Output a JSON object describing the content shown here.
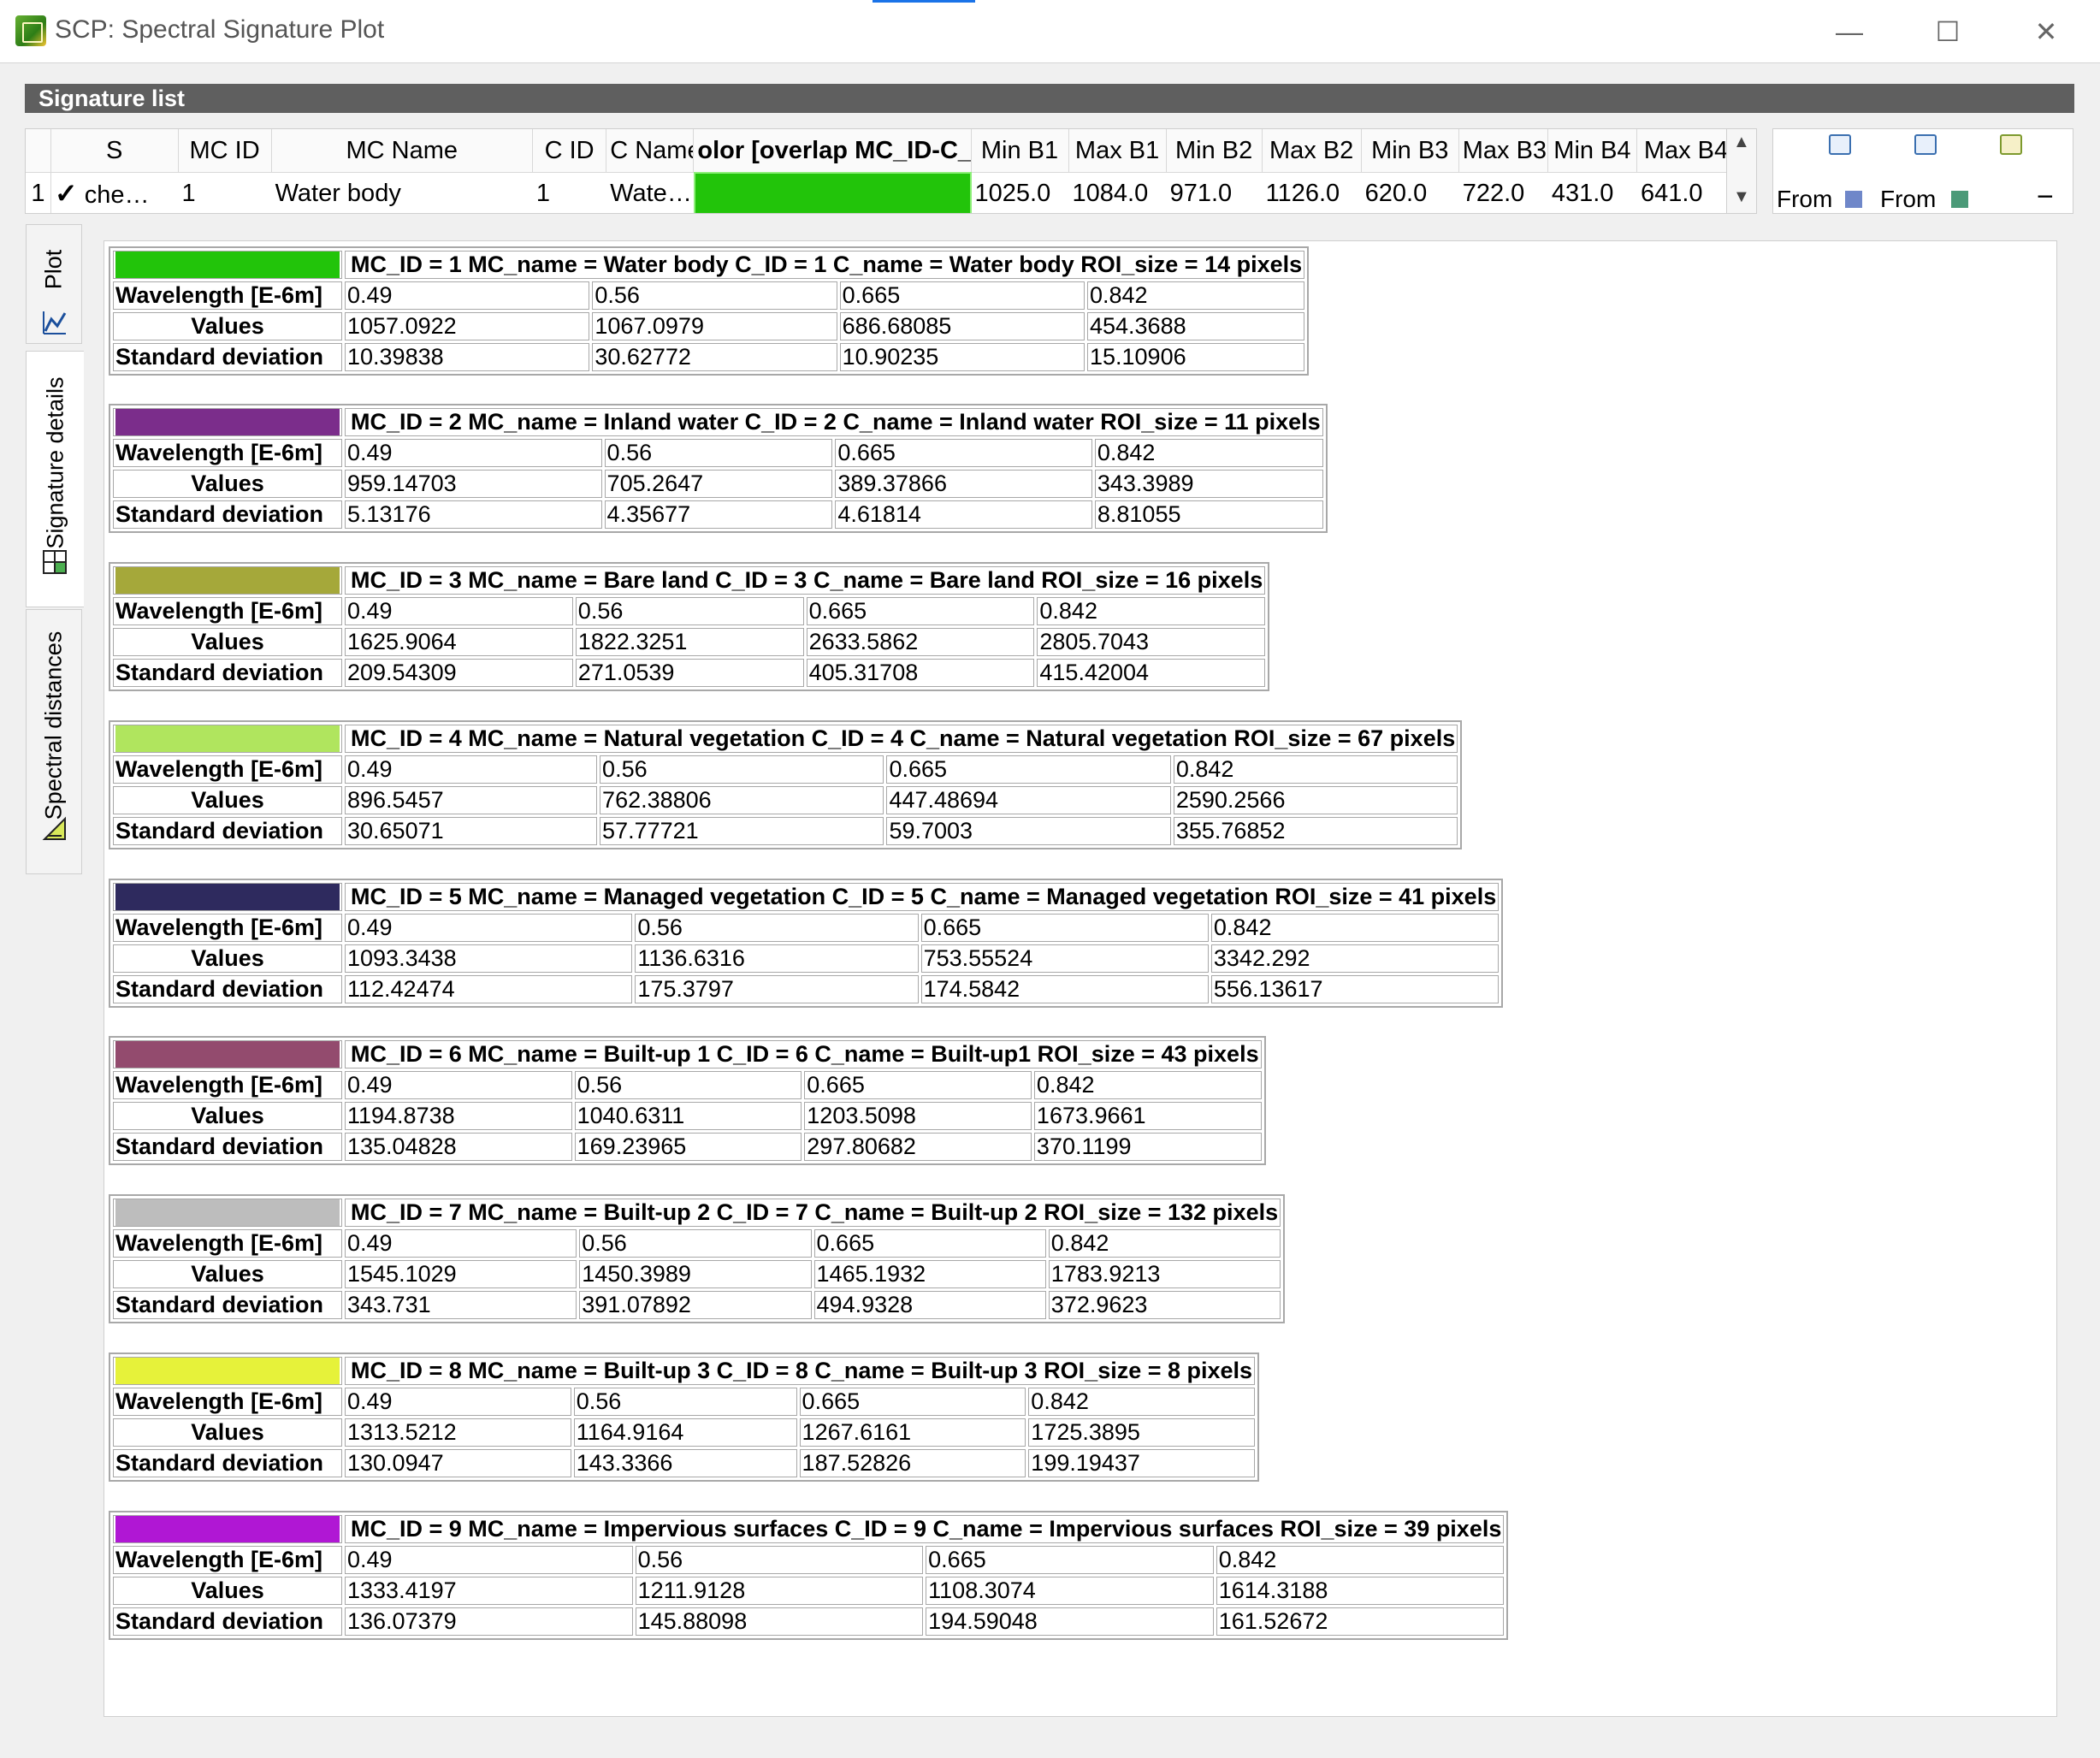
{
  "window": {
    "title": "SCP: Spectral Signature Plot",
    "minimize_icon": "minimize-icon",
    "maximize_icon": "maximize-icon",
    "close_icon": "close-icon"
  },
  "signature_list": {
    "header": "Signature list",
    "columns": [
      "S",
      "MC ID",
      "MC Name",
      "C ID",
      "C Name",
      "olor [overlap MC_ID-C_I",
      "Min B1",
      "Max B1",
      "Min B2",
      "Max B2",
      "Min B3",
      "Max B3",
      "Min B4",
      "Max B4"
    ],
    "row": {
      "index": "1",
      "check": "✓",
      "s": "che…",
      "mc_id": "1",
      "mc_name": "Water body",
      "c_id": "1",
      "c_name": "Wate…",
      "color": "#22c40a",
      "min_b1": "1025.0",
      "max_b1": "1084.0",
      "min_b2": "971.0",
      "max_b2": "1126.0",
      "min_b3": "620.0",
      "max_b3": "722.0",
      "min_b4": "431.0",
      "max_b4": "641.0"
    },
    "side_tools": {
      "from_label_1": "From",
      "from_label_2": "From",
      "minus_symbol": "−"
    }
  },
  "tabs": {
    "plot": "Plot",
    "signature_details": "Signature details",
    "spectral_distances": "Spectral distances"
  },
  "row_labels": {
    "wavelength": "Wavelength [E-6m]",
    "values": "Values",
    "std": "Standard deviation"
  },
  "signatures": [
    {
      "color": "#22c40a",
      "title": "MC_ID = 1 MC_name = Water body C_ID = 1 C_name = Water body ROI_size = 14 pixels",
      "wavelengths": [
        "0.49",
        "0.56",
        "0.665",
        "0.842"
      ],
      "values": [
        "1057.0922",
        "1067.0979",
        "686.68085",
        "454.3688"
      ],
      "std": [
        "10.39838",
        "30.62772",
        "10.90235",
        "15.10906"
      ]
    },
    {
      "color": "#7b2d8b",
      "title": "MC_ID = 2 MC_name = Inland water C_ID = 2 C_name = Inland water ROI_size = 11 pixels",
      "wavelengths": [
        "0.49",
        "0.56",
        "0.665",
        "0.842"
      ],
      "values": [
        "959.14703",
        "705.2647",
        "389.37866",
        "343.3989"
      ],
      "std": [
        "5.13176",
        "4.35677",
        "4.61814",
        "8.81055"
      ]
    },
    {
      "color": "#a5a83a",
      "title": "MC_ID = 3 MC_name = Bare land C_ID = 3 C_name = Bare land ROI_size = 16 pixels",
      "wavelengths": [
        "0.49",
        "0.56",
        "0.665",
        "0.842"
      ],
      "values": [
        "1625.9064",
        "1822.3251",
        "2633.5862",
        "2805.7043"
      ],
      "std": [
        "209.54309",
        "271.0539",
        "405.31708",
        "415.42004"
      ]
    },
    {
      "color": "#b0e55e",
      "title": "MC_ID = 4 MC_name = Natural vegetation C_ID = 4 C_name = Natural vegetation ROI_size = 67 pixels",
      "wavelengths": [
        "0.49",
        "0.56",
        "0.665",
        "0.842"
      ],
      "values": [
        "896.5457",
        "762.38806",
        "447.48694",
        "2590.2566"
      ],
      "std": [
        "30.65071",
        "57.77721",
        "59.7003",
        "355.76852"
      ]
    },
    {
      "color": "#2e2a5e",
      "title": "MC_ID = 5 MC_name = Managed vegetation C_ID = 5 C_name = Managed vegetation ROI_size = 41 pixels",
      "wavelengths": [
        "0.49",
        "0.56",
        "0.665",
        "0.842"
      ],
      "values": [
        "1093.3438",
        "1136.6316",
        "753.55524",
        "3342.292"
      ],
      "std": [
        "112.42474",
        "175.3797",
        "174.5842",
        "556.13617"
      ]
    },
    {
      "color": "#934b6e",
      "title": "MC_ID = 6 MC_name = Built-up 1 C_ID = 6 C_name = Built-up1 ROI_size = 43 pixels",
      "wavelengths": [
        "0.49",
        "0.56",
        "0.665",
        "0.842"
      ],
      "values": [
        "1194.8738",
        "1040.6311",
        "1203.5098",
        "1673.9661"
      ],
      "std": [
        "135.04828",
        "169.23965",
        "297.80682",
        "370.1199"
      ]
    },
    {
      "color": "#bdbdbd",
      "title": "MC_ID = 7 MC_name = Built-up 2 C_ID = 7 C_name = Built-up 2 ROI_size = 132 pixels",
      "wavelengths": [
        "0.49",
        "0.56",
        "0.665",
        "0.842"
      ],
      "values": [
        "1545.1029",
        "1450.3989",
        "1465.1932",
        "1783.9213"
      ],
      "std": [
        "343.731",
        "391.07892",
        "494.9328",
        "372.9623"
      ]
    },
    {
      "color": "#e6f23a",
      "title": "MC_ID = 8 MC_name = Built-up 3 C_ID = 8 C_name = Built-up 3 ROI_size = 8 pixels",
      "wavelengths": [
        "0.49",
        "0.56",
        "0.665",
        "0.842"
      ],
      "values": [
        "1313.5212",
        "1164.9164",
        "1267.6161",
        "1725.3895"
      ],
      "std": [
        "130.0947",
        "143.3366",
        "187.52826",
        "199.19437"
      ]
    },
    {
      "color": "#b017d4",
      "title": "MC_ID = 9 MC_name = Impervious surfaces C_ID = 9 C_name = Impervious surfaces ROI_size = 39 pixels",
      "wavelengths": [
        "0.49",
        "0.56",
        "0.665",
        "0.842"
      ],
      "values": [
        "1333.4197",
        "1211.9128",
        "1108.3074",
        "1614.3188"
      ],
      "std": [
        "136.07379",
        "145.88098",
        "194.59048",
        "161.52672"
      ]
    }
  ]
}
